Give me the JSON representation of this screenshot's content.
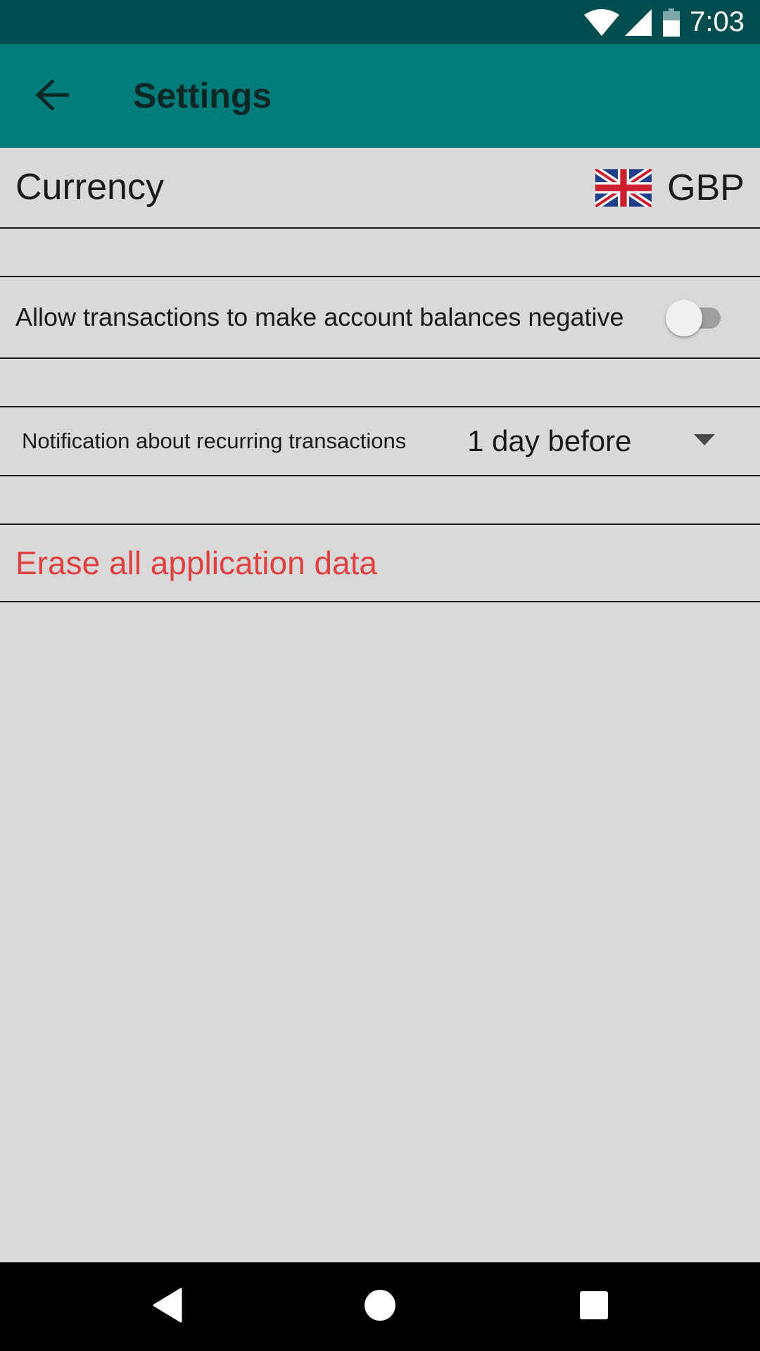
{
  "status_bar": {
    "time": "7:03",
    "icons": [
      "wifi-icon",
      "cell-signal-icon",
      "battery-icon"
    ]
  },
  "toolbar": {
    "title": "Settings",
    "back_icon": "arrow-back-icon"
  },
  "settings": {
    "currency": {
      "label": "Currency",
      "value": "GBP",
      "flag_icon": "uk-flag-icon"
    },
    "negative_balances": {
      "label": "Allow transactions to make account balances negative",
      "enabled": false
    },
    "recurring_notification": {
      "label": "Notification about recurring transactions",
      "selected": "1 day before"
    },
    "erase": {
      "label": "Erase all application data"
    }
  },
  "nav_bar": {
    "buttons": [
      "back-triangle-icon",
      "home-circle-icon",
      "recents-square-icon"
    ]
  },
  "colors": {
    "status_bar": "#004d4f",
    "toolbar": "#007d7a",
    "background": "#d9d9d9",
    "danger_text": "#e0403f",
    "divider": "#1b1b1b"
  }
}
